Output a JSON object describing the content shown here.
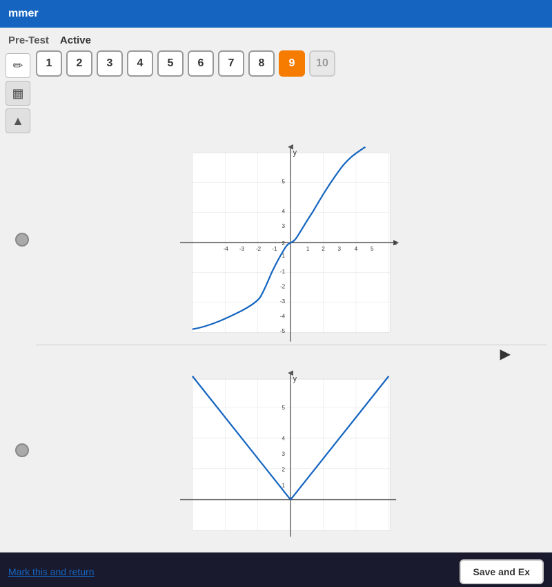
{
  "topBar": {
    "title": "mmer"
  },
  "header": {
    "preTest": "Pre-Test",
    "active": "Active"
  },
  "numberButtons": [
    {
      "label": "1",
      "state": "normal"
    },
    {
      "label": "2",
      "state": "normal"
    },
    {
      "label": "3",
      "state": "normal"
    },
    {
      "label": "4",
      "state": "normal"
    },
    {
      "label": "5",
      "state": "normal"
    },
    {
      "label": "6",
      "state": "normal"
    },
    {
      "label": "7",
      "state": "normal"
    },
    {
      "label": "8",
      "state": "normal"
    },
    {
      "label": "9",
      "state": "selected"
    },
    {
      "label": "10",
      "state": "disabled"
    }
  ],
  "toolbar": {
    "tools": [
      {
        "name": "pencil",
        "icon": "✏️"
      },
      {
        "name": "calculator",
        "icon": "🧮"
      },
      {
        "name": "up-arrow",
        "icon": "▲"
      }
    ]
  },
  "bottomBar": {
    "markReturn": "Mark this and return",
    "saveButton": "Save and Ex"
  }
}
